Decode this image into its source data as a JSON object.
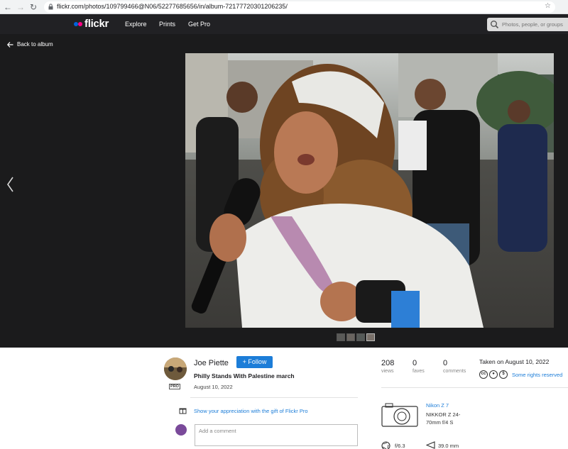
{
  "browser": {
    "url": "flickr.com/photos/109799466@N06/52277685656/in/album-72177720301206235/"
  },
  "header": {
    "logo_text": "flickr",
    "nav": [
      "Explore",
      "Prints",
      "Get Pro"
    ],
    "search_placeholder": "Photos, people, or groups"
  },
  "viewer": {
    "back_label": "Back to album",
    "thumbnail_count": 4
  },
  "photo_info": {
    "owner": "Joe Piette",
    "owner_badge": "PRO",
    "follow_label": "Follow",
    "title": "Philly Stands With Palestine march",
    "date": "August 10, 2022",
    "appreciation_text": "Show your appreciation with the gift of Flickr Pro",
    "comment_placeholder": "Add a comment"
  },
  "stats": [
    {
      "value": "208",
      "label": "views"
    },
    {
      "value": "0",
      "label": "faves"
    },
    {
      "value": "0",
      "label": "comments"
    }
  ],
  "taken": {
    "text": "Taken on August 10, 2022",
    "license": "Some rights reserved",
    "license_icons": [
      "cc",
      "by",
      "nc"
    ]
  },
  "exif": {
    "camera": "Nikon Z 7",
    "lens": "NIKKOR Z 24-70mm f/4 S",
    "aperture": "f/6.3",
    "focal_length": "39.0 mm"
  },
  "colors": {
    "flickr_blue": "#0063dc",
    "flickr_pink": "#ff0084",
    "link": "#1c7dd8",
    "header_bg": "#212124",
    "stage_bg": "#1b1b1c"
  }
}
